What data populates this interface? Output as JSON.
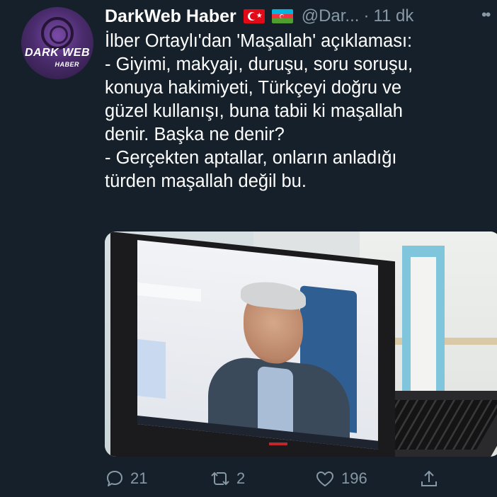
{
  "tweet": {
    "author": {
      "name": "DarkWeb Haber",
      "handle": "@Dar...",
      "avatar_text": "DARK WEB",
      "avatar_subtext": "HABER"
    },
    "separator": "·",
    "time": "11 dk",
    "flags": [
      "turkey-flag-icon",
      "azerbaijan-flag-icon"
    ],
    "more_label": "••",
    "text_lines": [
      "İlber Ortaylı'dan 'Maşallah' açıklaması:",
      "- Giyimi, makyajı, duruşu, soru soruşu,",
      "konuya hakimiyeti, Türkçeyi doğru ve",
      "güzel kullanışı, buna tabii ki maşallah",
      "denir. Başka ne denir?",
      "- Gerçekten aptallar, onların anladığı",
      "türden maşallah değil bu."
    ],
    "media": {
      "description_icon": "laptop-video-call-photo"
    },
    "actions": {
      "reply_count": "21",
      "retweet_count": "2",
      "like_count": "196"
    }
  },
  "colors": {
    "background": "#15202b",
    "secondary_text": "#8899a6",
    "primary_text": "#ffffff"
  }
}
